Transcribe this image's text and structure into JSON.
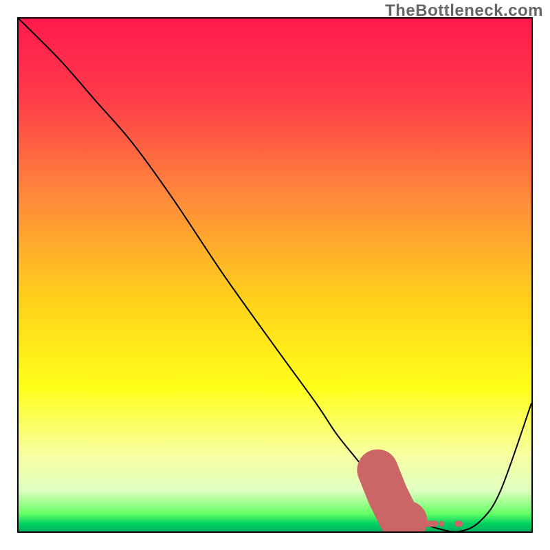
{
  "watermark": "TheBottleneck.com",
  "colors": {
    "gradient_stops": [
      {
        "offset": 0.0,
        "color": "#ff1a4d"
      },
      {
        "offset": 0.15,
        "color": "#ff3a4a"
      },
      {
        "offset": 0.35,
        "color": "#ff8a3a"
      },
      {
        "offset": 0.55,
        "color": "#ffd21a"
      },
      {
        "offset": 0.72,
        "color": "#ffff1a"
      },
      {
        "offset": 0.85,
        "color": "#f7ffa0"
      },
      {
        "offset": 0.92,
        "color": "#e0ffc0"
      },
      {
        "offset": 0.965,
        "color": "#66ff66"
      },
      {
        "offset": 0.985,
        "color": "#00d060"
      },
      {
        "offset": 1.0,
        "color": "#00b060"
      }
    ],
    "curve": "#000000",
    "marker": "#cc6666"
  },
  "chart_data": {
    "type": "line",
    "title": "",
    "xlabel": "",
    "ylabel": "",
    "xlim": [
      0,
      100
    ],
    "ylim": [
      0,
      100
    ],
    "series": [
      {
        "name": "bottleneck-curve",
        "x": [
          0,
          8,
          15,
          22,
          30,
          40,
          50,
          58,
          62,
          66,
          70,
          74,
          78,
          82,
          86,
          90,
          94,
          100
        ],
        "y": [
          100,
          92,
          84,
          76,
          65,
          50,
          36,
          25,
          19,
          14,
          9,
          5,
          2,
          0.5,
          0,
          2,
          8,
          25
        ]
      },
      {
        "name": "optimal-marker",
        "x": [
          70,
          72,
          73.5,
          74.5,
          77,
          79,
          82,
          85
        ],
        "y": [
          12,
          7,
          4,
          2,
          1.5,
          1.5,
          1.5,
          1.5
        ]
      }
    ],
    "optimal_range_x": [
      74,
      86
    ]
  }
}
